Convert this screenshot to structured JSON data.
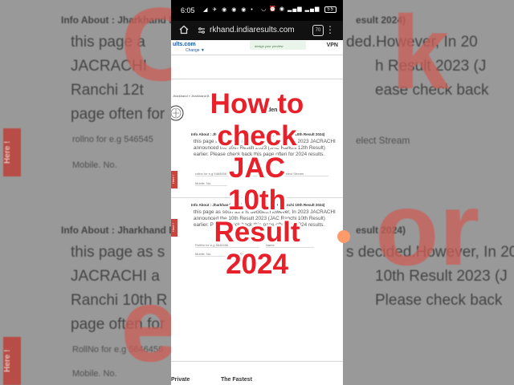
{
  "status_bar": {
    "time": "6:05",
    "left_icons": "◢ ✈ ◉ ◉ ◉ •",
    "right_icons": "◡ ⏰ ◉ ▂▄▆ ▂▄▆",
    "battery": "55"
  },
  "browser": {
    "url": "rkhand.indiaresults.com",
    "tab_count": "70"
  },
  "site": {
    "logo": "ults.com",
    "logo_sub": "Change ▼",
    "ad_text": "design your preview",
    "vpn": "VPN",
    "breadcrumb": "Jharkhand » Jharkhand B...",
    "heading_fragment": "den"
  },
  "content": {
    "info_title_1": "Info About : Jharkhand Board 10th Result 2024 (JAC Ranchi 10th Result 2024)",
    "para_1": "this page as soon as it is decided.However, In 2023 JACRACHI announced the 10th Result 2023 (JAC Ranchi 12th Result) earlier. Please check back this page often for 2024 results.",
    "field_rollno_1": "rollno for e.g 5465456",
    "field_stream": "Select Stream",
    "field_mobile_1": "Mobile. No.",
    "info_title_2": "Info About : Jharkhand Board 10th Result 2024 (JAC Ranchi 10th Result 2024)",
    "para_2": "this page as soon as it is decided.However, In 2023 JACRACHI announced the 10th Result 2023 (JAC Ranchi 10th Result) earlier. Please check back this page often for 2024 results.",
    "field_rollno_2": "RollNo for e.g 5646456",
    "field_name": "Name",
    "field_mobile_2": "Mobile. No.",
    "field_email": "Email ID",
    "help_tab": "Here !",
    "bottom_left": "Private",
    "bottom_right": "The Fastest"
  },
  "background": {
    "left_title_1": "Info About : Jharkhand B",
    "left_para_1a": "this page a",
    "left_para_1b": "JACRACHI",
    "left_para_1c": "Ranchi 12t",
    "left_para_1d": "page often for",
    "left_field_1": "rollno for e.g 546545",
    "left_field_2": "Mobile. No.",
    "left_title_2": "Info About : Jharkhand B",
    "left_para_2a": "this page as s",
    "left_para_2b": "JACRACHI  a",
    "left_para_2c": "Ranchi 10th R",
    "left_para_2d": "page often for",
    "left_field_3": "RollNo for e.g 5646456",
    "left_field_4": "Mobile. No.",
    "left_tab": "Here !",
    "right_title_1": "esult 2024)",
    "right_para_1a": "ded.However, In 20",
    "right_para_1b": "h Result 2023 (J",
    "right_para_1c": "ease check back",
    "right_field_1": "elect Stream",
    "right_title_2": "esult 2024)",
    "right_para_2a": "s decided.However, In 20",
    "right_para_2b": "10th Result 2023 (J",
    "right_para_2c": "Please check back",
    "big_letter_left": "C",
    "big_letter_right": "k",
    "big_letter_left_2": "e",
    "big_letter_right_2": "or"
  },
  "overlay": {
    "line1": "How to",
    "line2": "check",
    "line3": "JAC",
    "line4": "10th",
    "line5": "Result",
    "line6": "2024"
  }
}
